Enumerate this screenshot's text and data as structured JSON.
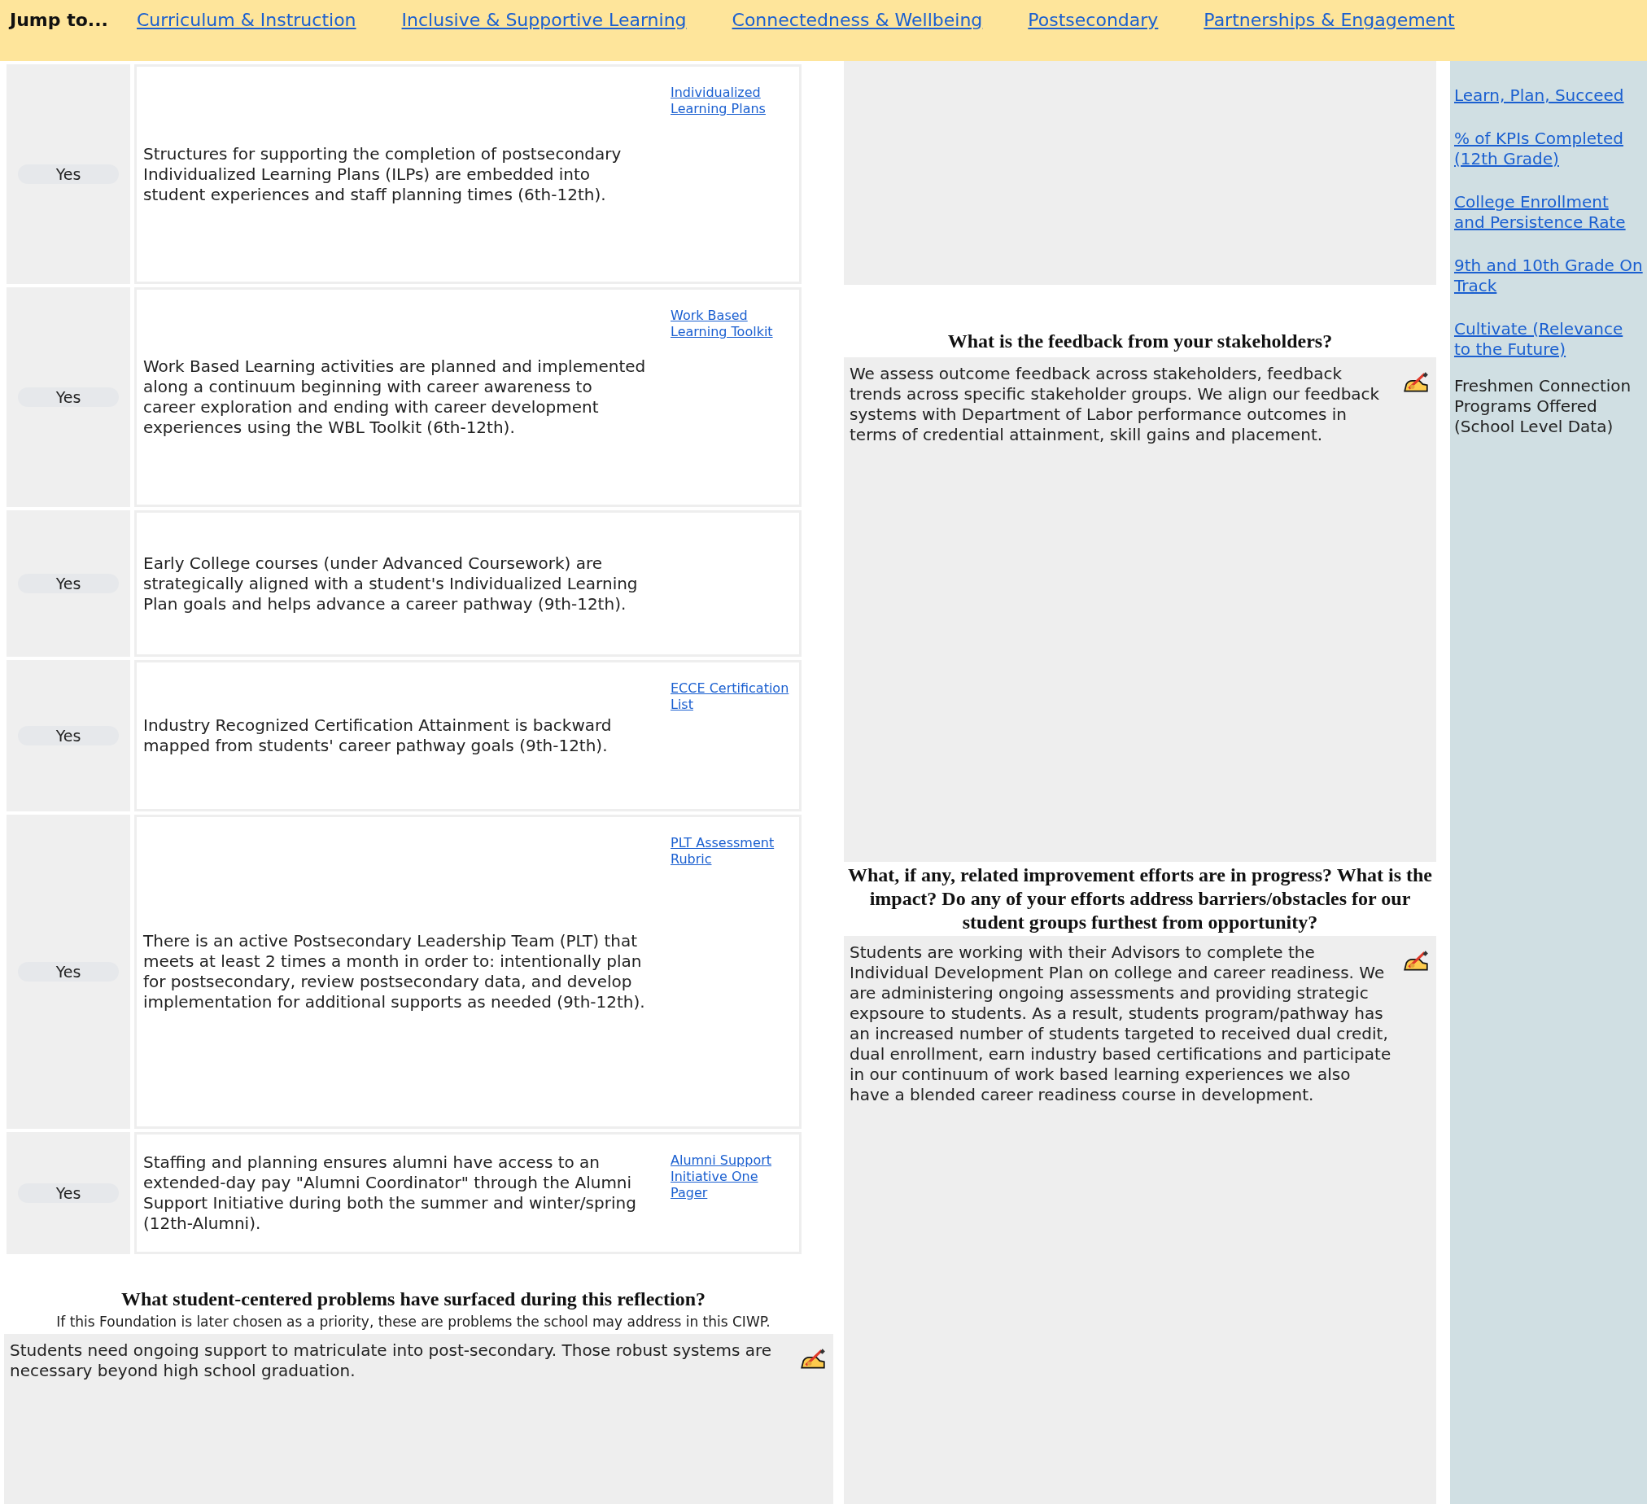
{
  "nav": {
    "label": "Jump to...",
    "links": [
      "Curriculum & Instruction",
      "Inclusive & Supportive Learning",
      "Connectedness & Wellbeing",
      "Postsecondary",
      "Partnerships & Engagement"
    ]
  },
  "practices": [
    {
      "status": "Yes",
      "text": "Structures for supporting the completion of postsecondary Individualized Learning Plans (ILPs) are embedded into student experiences and staff planning times (6th-12th).",
      "resource": "Individualized Learning Plans"
    },
    {
      "status": "Yes",
      "text": "Work Based Learning activities are planned and implemented along a continuum beginning with career awareness to career exploration and ending with career development experiences using the WBL Toolkit (6th-12th).",
      "resource": "Work Based Learning Toolkit"
    },
    {
      "status": "Yes",
      "text": "Early College courses (under Advanced Coursework) are strategically aligned with a student's Individualized Learning Plan goals and helps advance a career pathway (9th-12th)."
    },
    {
      "status": "Yes",
      "text": "Industry Recognized Certification Attainment is backward mapped from students' career pathway goals (9th-12th).",
      "resource": "ECCE Certification List"
    },
    {
      "status": "Yes",
      "text": "There is an active Postsecondary Leadership Team (PLT) that meets at least 2 times a month in order to: intentionally plan for postsecondary, review postsecondary data, and develop implementation for additional supports as needed (9th-12th).",
      "resource": "PLT Assessment Rubric"
    },
    {
      "status": "Yes",
      "text": "Staffing and planning ensures alumni have access to an extended-day pay \"Alumni Coordinator\" through the Alumni Support Initiative during both the summer and winter/spring (12th-Alumni).",
      "resource": "Alumni Support Initiative One Pager"
    }
  ],
  "problems": {
    "question": "What student-centered problems have surfaced during this reflection?",
    "hint": "If this Foundation is later chosen as a priority, these are problems the school may address in this CIWP.",
    "answer": "Students need ongoing support to matriculate into post-secondary.  Those robust systems are necessary beyond high school graduation."
  },
  "feedback": {
    "question": "What is the feedback from your stakeholders?",
    "answer": "We assess outcome feedback across stakeholders, feedback trends across specific stakeholder groups.  We align our feedback systems with Department of Labor performance outcomes in terms of credential attainment, skill gains and placement."
  },
  "efforts": {
    "question": "What, if any, related improvement efforts are in progress?  What is the impact?  Do any of your efforts address barriers/obstacles for our student groups furthest from opportunity?",
    "answer": "Students are working with their Advisors to complete the Individual Development Plan on college and career readiness.  We are administering ongoing assessments and providing strategic expsoure to students.  As a result, students program/pathway has an increased number of students targeted to received dual credit, dual enrollment, earn industry based certifications and participate in our continuum of work based learning experiences we also have a blended career readiness course in development."
  },
  "metrics": [
    {
      "kind": "link",
      "text": "Learn, Plan, Succeed"
    },
    {
      "kind": "link",
      "text": "% of KPIs Completed (12th Grade)"
    },
    {
      "kind": "link",
      "text": "College Enrollment and Persistence Rate"
    },
    {
      "kind": "link",
      "text": "9th and 10th Grade On Track"
    },
    {
      "kind": "link",
      "text": "Cultivate (Relevance to the Future)"
    },
    {
      "kind": "text",
      "text": "Freshmen Connection Programs Offered (School Level Data)"
    }
  ]
}
